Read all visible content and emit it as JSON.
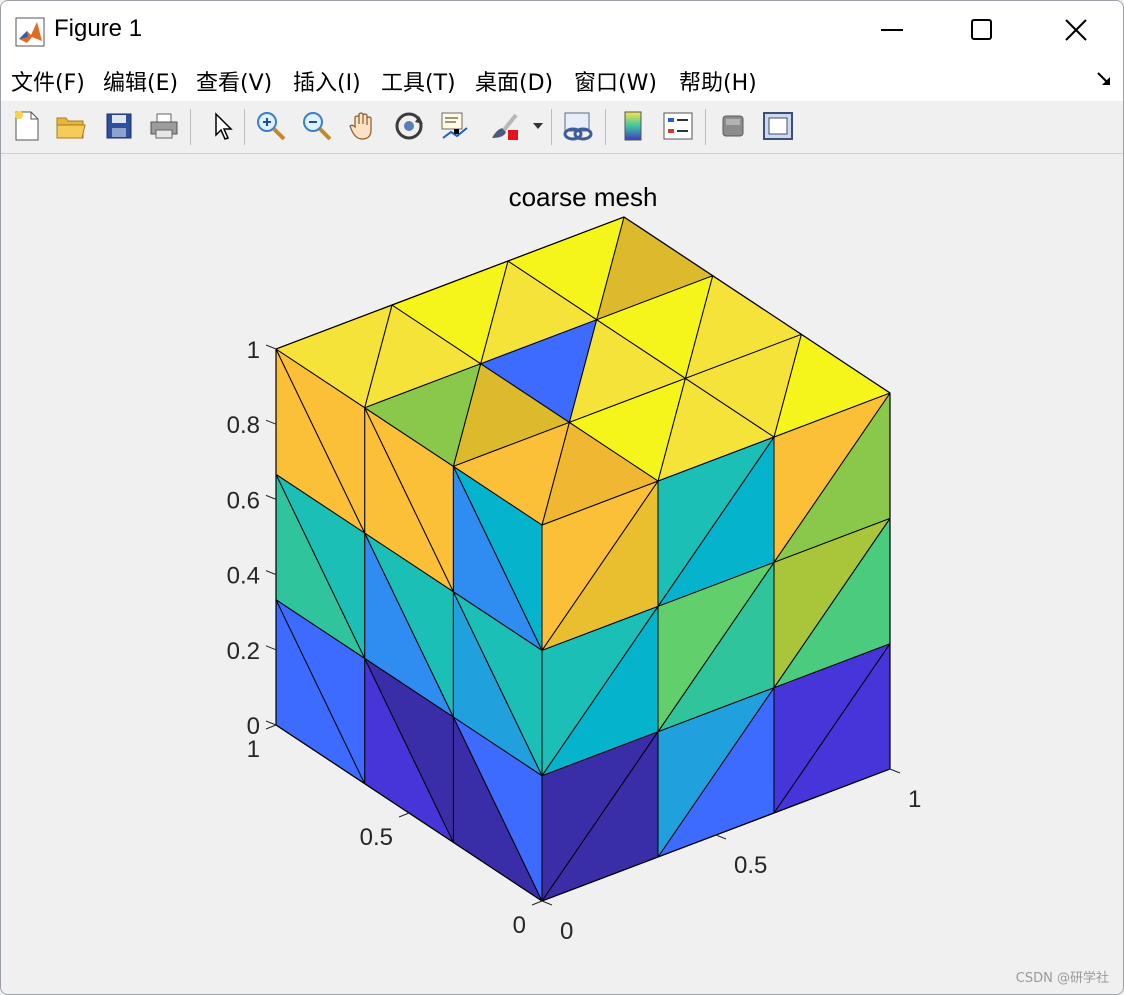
{
  "window": {
    "title": "Figure 1"
  },
  "menu": {
    "items": [
      "文件(F)",
      "编辑(E)",
      "查看(V)",
      "插入(I)",
      "工具(T)",
      "桌面(D)",
      "窗口(W)",
      "帮助(H)"
    ]
  },
  "toolbar": {
    "icons": [
      "new-file-icon",
      "open-folder-icon",
      "save-icon",
      "print-icon",
      "pointer-icon",
      "zoom-in-icon",
      "zoom-out-icon",
      "pan-hand-icon",
      "rotate-3d-icon",
      "data-cursor-icon",
      "brush-icon",
      "link-plot-icon",
      "colorbar-icon",
      "legend-icon",
      "hide-plot-tools-icon",
      "show-plot-tools-icon"
    ]
  },
  "chart_data": {
    "type": "surface-mesh",
    "title": "coarse mesh",
    "zlim": [
      0,
      1
    ],
    "z_ticks": [
      "0",
      "0.2",
      "0.4",
      "0.6",
      "0.8",
      "1"
    ],
    "x_ticks": [
      "0",
      "0.5",
      "1"
    ],
    "y_ticks": [
      "0",
      "0.5",
      "1"
    ],
    "colormap": "parula"
  },
  "watermark": "CSDN @研学社"
}
